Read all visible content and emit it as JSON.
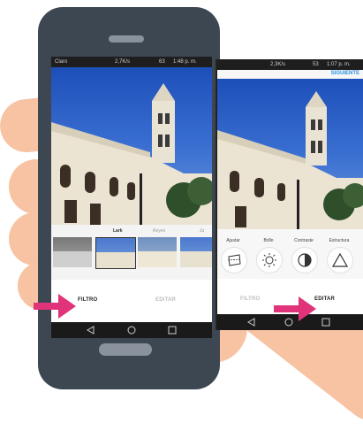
{
  "colors": {
    "accent_arrow": "#e0337a",
    "sky": "#2a5cc4",
    "phone_body": "#3d4752",
    "skin": "#f7c3a3"
  },
  "left_screen": {
    "status": {
      "carrier": "Claro",
      "speed": "2,7K/s",
      "battery": "63",
      "time": "1:48 p. m."
    },
    "filters": [
      "Lark",
      "Reyes",
      "Ju"
    ],
    "tabs": {
      "filtro": "FILTRO",
      "editar": "EDITAR",
      "active": "FILTRO"
    }
  },
  "right_screen": {
    "status": {
      "speed": "2,3K/s",
      "battery": "53",
      "time": "1:07 p. m."
    },
    "header_action": "SIGUIENTE",
    "tools": [
      "Ajustar",
      "Brillo",
      "Contraste",
      "Estructura"
    ],
    "tabs": {
      "filtro": "FILTRO",
      "editar": "EDITAR",
      "active": "EDITAR"
    }
  },
  "nav_icons": [
    "back-icon",
    "home-icon",
    "recents-icon"
  ]
}
